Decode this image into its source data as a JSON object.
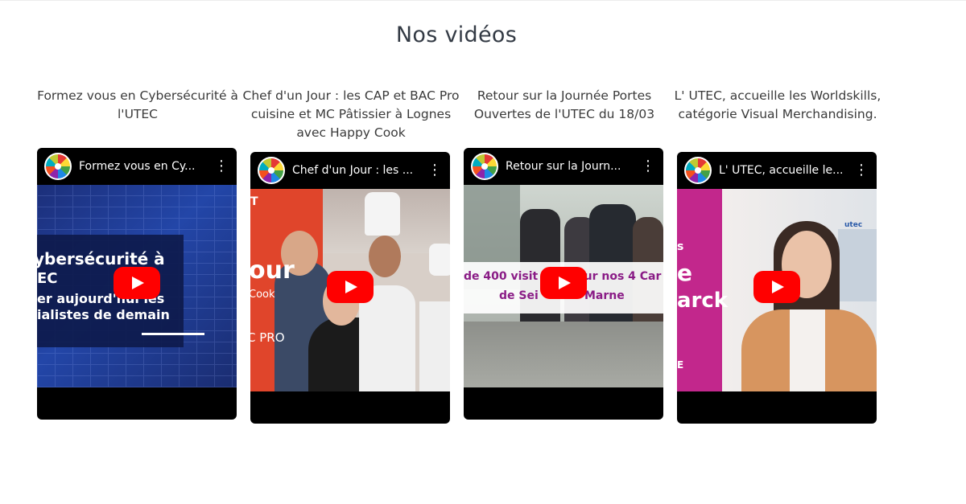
{
  "section": {
    "title": "Nos vidéos"
  },
  "videos": [
    {
      "title": "Formez vous en Cybersécurité à l'UTEC",
      "player_title": "Formez vous en Cy...",
      "overlay": [
        "ybersécurité à",
        "EC",
        "er aujourd'hui les",
        "ialistes de demain"
      ]
    },
    {
      "title": "Chef d'un Jour : les CAP et BAC Pro cuisine et MC Pâtissier à Lognes avec Happy Cook",
      "player_title": "Chef d'un Jour : les ...",
      "overlay": [
        "T",
        "our",
        "Cook",
        "C PRO"
      ]
    },
    {
      "title": "Retour sur la Journée Portes Ouvertes de l'UTEC du 18/03",
      "player_title": "Retour sur la Journ...",
      "overlay": [
        "de 400 visit",
        "our nos 4 Car",
        "de Sei",
        "Marne"
      ]
    },
    {
      "title": "L' UTEC, accueille les Worldskills, catégorie Visual Merchandising.",
      "player_title": "L' UTEC, accueille le...",
      "overlay": [
        "s",
        "e",
        "arck",
        "E",
        "utec"
      ]
    }
  ],
  "icons": {
    "play": "youtube-play-icon",
    "more": "kebab-menu-icon",
    "channel": "utec-logo-icon"
  },
  "colors": {
    "youtube_red": "#ff0000",
    "title_text": "#333a44"
  }
}
